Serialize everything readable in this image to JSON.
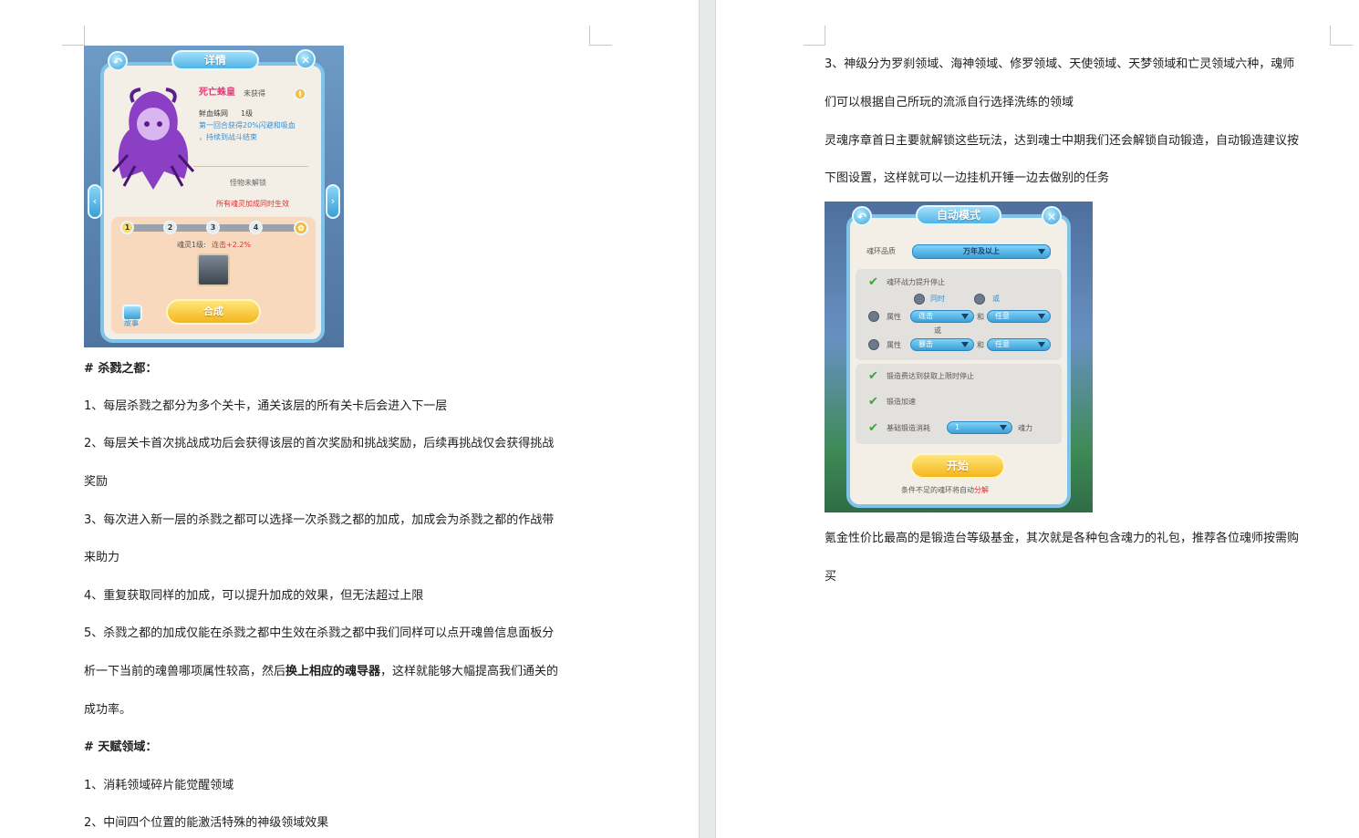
{
  "left_page": {
    "heading_kill_city": "# 杀戮之都：",
    "kill_city_lines": [
      "1、每层杀戮之都分为多个关卡，通关该层的所有关卡后会进入下一层",
      "2、每层关卡首次挑战成功后会获得该层的首次奖励和挑战奖励，后续再挑战仅会获得挑战",
      "奖励",
      "3、每次进入新一层的杀戮之都可以选择一次杀戮之都的加成，加成会为杀戮之都的作战带",
      "来助力",
      "4、重复获取同样的加成，可以提升加成的效果，但无法超过上限",
      "5、杀戮之都的加成仅能在杀戮之都中生效在杀戮之都中我们同样可以点开魂兽信息面板分"
    ],
    "line_with_bold": {
      "prefix": "析一下当前的魂兽哪项属性较高，然后",
      "bold": "换上相应的魂导器",
      "suffix": "，这样就能够大幅提高我们通关的"
    },
    "kill_city_last": "成功率。",
    "heading_talent": "# 天赋领域：",
    "talent_lines": [
      "1、消耗领域碎片能觉醒领域",
      "2、中间四个位置的能激活特殊的神级领域效果"
    ]
  },
  "right_page": {
    "lines_top": [
      "3、神级分为罗刹领域、海神领域、修罗领域、天使领域、天梦领域和亡灵领域六种，魂师",
      "们可以根据自己所玩的流派自行选择洗练的领域",
      "灵魂序章首日主要就解锁这些玩法，达到魂士中期我们还会解锁自动锻造，自动锻造建议按",
      "下图设置，这样就可以一边挂机开锤一边去做别的任务"
    ],
    "lines_bottom": [
      "氪金性价比最高的是锻造台等级基金，其次就是各种包含魂力的礼包，推荐各位魂师按需购",
      "买"
    ]
  },
  "shot1": {
    "title": "详情",
    "monster_name": "死亡蛛皇",
    "status": "未获得",
    "skill": "鲜血蛛网",
    "skill_level": "1级",
    "skill_desc_1": "第一回合获得20%闪避和吸血",
    "skill_desc_2": "，持续到战斗结束",
    "locked": "怪物未解锁",
    "unlock_note": "所有魂灵加成同时生效",
    "steps": [
      "1",
      "2",
      "3",
      "4"
    ],
    "bonus_label": "魂灵1级:",
    "bonus_value": "连击+2.2%",
    "story": "故事",
    "combine": "合成",
    "icons": [
      "back-icon",
      "close-icon",
      "info-icon",
      "arrow-left-icon",
      "arrow-right-icon",
      "paw-icon",
      "book-icon"
    ]
  },
  "shot2": {
    "title": "自动模式",
    "ring_label": "魂环品质",
    "ring_value": "万年及以上",
    "opt_ring_upgrade": "魂环战力提升停止",
    "opt_same_time": "同时",
    "opt_or": "或",
    "attr_label": "属性",
    "attr1_value": "连击",
    "and_label": "和",
    "any_value": "任意",
    "or_middle": "或",
    "attr2_value": "暴击",
    "opt_level_limit": "锻造费达到获取上限时停止",
    "opt_speedup": "锻造加速",
    "opt_cost_label": "基础锻造消耗",
    "cost_value": "1",
    "cost_unit": "魂力",
    "start": "开始",
    "footer_prefix": "条件不足的魂环将自动",
    "footer_action": "分解",
    "colors": {
      "accent_blue": "#3d9fd8",
      "check_green": "#3ca33c",
      "gold": "#f5b51c",
      "red": "#e03030"
    }
  }
}
